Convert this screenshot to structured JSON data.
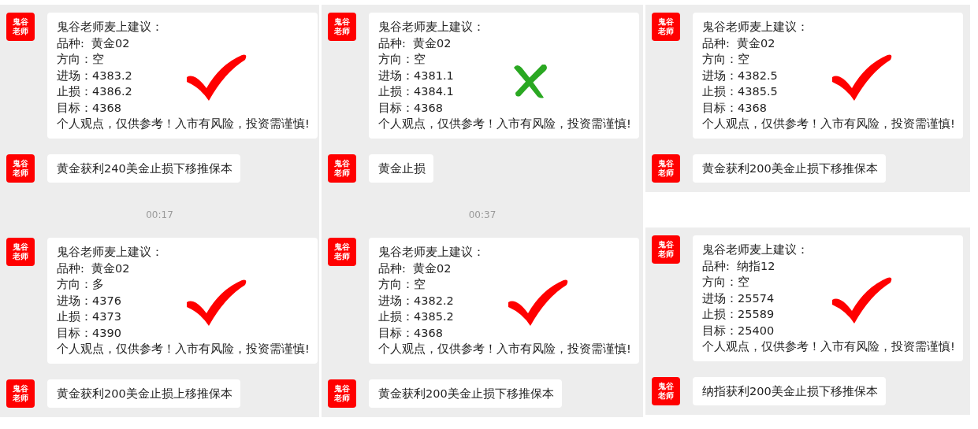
{
  "columns": [
    {
      "panels": [
        {
          "kind": "check",
          "timestamp": "00:17",
          "messages": [
            {
              "avatar": [
                "鬼谷",
                "老师"
              ],
              "lines": [
                "鬼谷老师麦上建议：",
                "品种:  黄金02",
                "方向：空",
                "进场：4383.2",
                "止损：4386.2",
                "目标：4368",
                "个人观点，仅供参考！入市有风险，投资需谨慎!"
              ]
            },
            {
              "avatar": [
                "鬼谷",
                "老师"
              ],
              "lines": [
                "黄金获利240美金止损下移推保本"
              ]
            }
          ]
        },
        {
          "kind": "check",
          "messages": [
            {
              "avatar": [
                "鬼谷",
                "老师"
              ],
              "lines": [
                "鬼谷老师麦上建议：",
                "品种:  黄金02",
                "方向：多",
                "进场：4376",
                "止损：4373",
                "目标：4390",
                "个人观点，仅供参考！入市有风险，投资需谨慎!"
              ]
            },
            {
              "avatar": [
                "鬼谷",
                "老师"
              ],
              "lines": [
                "黄金获利200美金止损上移推保本"
              ]
            }
          ]
        }
      ]
    },
    {
      "panels": [
        {
          "kind": "cross",
          "timestamp": "00:37",
          "messages": [
            {
              "avatar": [
                "鬼谷",
                "老师"
              ],
              "lines": [
                "鬼谷老师麦上建议：",
                "品种:  黄金02",
                "方向：空",
                "进场：4381.1",
                "止损：4384.1",
                "目标：4368",
                "个人观点，仅供参考！入市有风险，投资需谨慎!"
              ]
            },
            {
              "avatar": [
                "鬼谷",
                "老师"
              ],
              "lines": [
                "黄金止损"
              ]
            }
          ]
        },
        {
          "kind": "check",
          "messages": [
            {
              "avatar": [
                "鬼谷",
                "老师"
              ],
              "lines": [
                "鬼谷老师麦上建议：",
                "品种:  黄金02",
                "方向：空",
                "进场：4382.2",
                "止损：4385.2",
                "目标：4368",
                "个人观点，仅供参考！入市有风险，投资需谨慎!"
              ]
            },
            {
              "avatar": [
                "鬼谷",
                "老师"
              ],
              "lines": [
                "黄金获利200美金止损下移推保本"
              ]
            }
          ]
        }
      ]
    },
    {
      "panels": [
        {
          "kind": "check",
          "messages": [
            {
              "avatar": [
                "鬼谷",
                "老师"
              ],
              "lines": [
                "鬼谷老师麦上建议：",
                "品种:  黄金02",
                "方向：空",
                "进场：4382.5",
                "止损：4385.5",
                "目标：4368",
                "个人观点，仅供参考！入市有风险，投资需谨慎!"
              ]
            },
            {
              "avatar": [
                "鬼谷",
                "老师"
              ],
              "lines": [
                "黄金获利200美金止损下移推保本"
              ]
            }
          ]
        },
        {
          "kind": "check",
          "messages": [
            {
              "avatar": [
                "鬼谷",
                "老师"
              ],
              "lines": [
                "鬼谷老师麦上建议：",
                "品种:  纳指12",
                "方向：空",
                "进场：25574",
                "止损：25589",
                "目标：25400",
                "个人观点，仅供参考！入市有风险，投资需谨慎!"
              ]
            },
            {
              "avatar": [
                "鬼谷",
                "老师"
              ],
              "lines": [
                "纳指获利200美金止损下移推保本"
              ]
            }
          ]
        }
      ]
    }
  ]
}
